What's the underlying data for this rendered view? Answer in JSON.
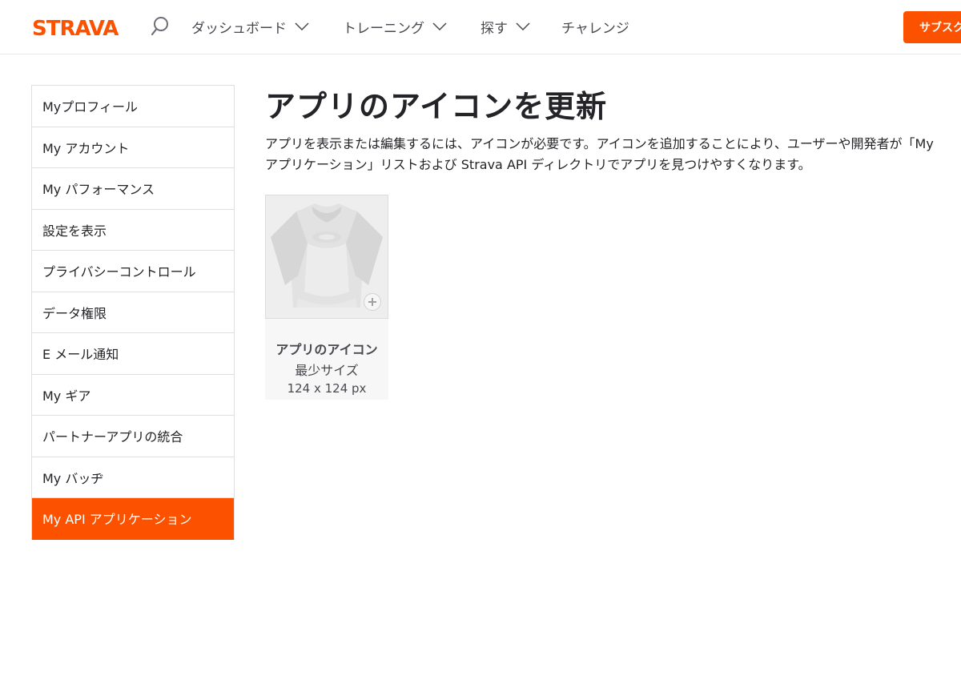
{
  "header": {
    "logo_text": "STRAVA",
    "nav": [
      {
        "label": "ダッシュボード"
      },
      {
        "label": "トレーニング"
      },
      {
        "label": "探す"
      },
      {
        "label": "チャレンジ"
      }
    ],
    "subscribe_label": "サブスク"
  },
  "sidebar": {
    "items": [
      {
        "label": "Myプロフィール"
      },
      {
        "label": "My アカウント"
      },
      {
        "label": "My パフォーマンス"
      },
      {
        "label": "設定を表示"
      },
      {
        "label": "プライバシーコントロール"
      },
      {
        "label": "データ権限"
      },
      {
        "label": "E メール通知"
      },
      {
        "label": "My ギア"
      },
      {
        "label": "パートナーアプリの統合"
      },
      {
        "label": "My バッヂ"
      },
      {
        "label": "My API アプリケーション"
      }
    ]
  },
  "main": {
    "title": "アプリのアイコンを更新",
    "description": "アプリを表示または編集するには、アイコンが必要です。アイコンを追加することにより、ユーザーや開発者が「Myアプリケーション」リストおよび Strava API ディレクトリでアプリを見つけやすくなります。",
    "icon_card": {
      "title": "アプリのアイコン",
      "subtitle": "最少サイズ",
      "size": "124 x 124 px"
    }
  },
  "colors": {
    "brand": "#fc5200",
    "text": "#242428",
    "border": "#dfdfe3"
  }
}
